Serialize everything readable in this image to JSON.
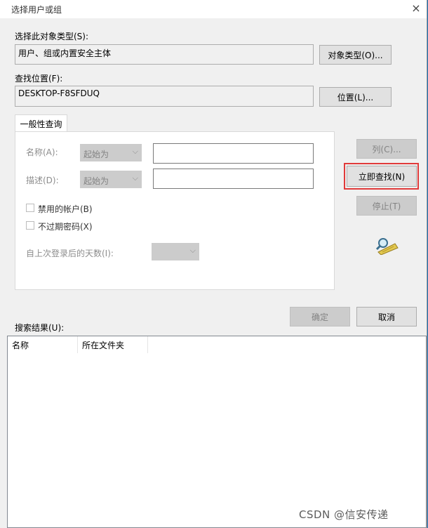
{
  "window": {
    "title": "选择用户或组",
    "close_glyph": "×"
  },
  "object_type": {
    "label": "选择此对象类型(S):",
    "value": "用户、组或内置安全主体",
    "button": "对象类型(O)..."
  },
  "location": {
    "label": "查找位置(F):",
    "value": "DESKTOP-F8SFDUQ",
    "button": "位置(L)..."
  },
  "tabs": [
    {
      "label": "一般性查询"
    }
  ],
  "query": {
    "name_label": "名称(A):",
    "name_mode": "起始为",
    "desc_label": "描述(D):",
    "desc_mode": "起始为",
    "disabled_accounts": "禁用的帐户(B)",
    "non_expiring_pw": "不过期密码(X)",
    "days_label": "自上次登录后的天数(I):"
  },
  "buttons": {
    "columns": "列(C)...",
    "find_now": "立即查找(N)",
    "stop": "停止(T)",
    "ok": "确定",
    "cancel": "取消"
  },
  "results": {
    "label": "搜索结果(U):",
    "columns": [
      "名称",
      "所在文件夹"
    ]
  },
  "watermark": "CSDN @信安传递",
  "colors": {
    "highlight": "#e03a3a",
    "desktop": "#1f6fb3"
  }
}
